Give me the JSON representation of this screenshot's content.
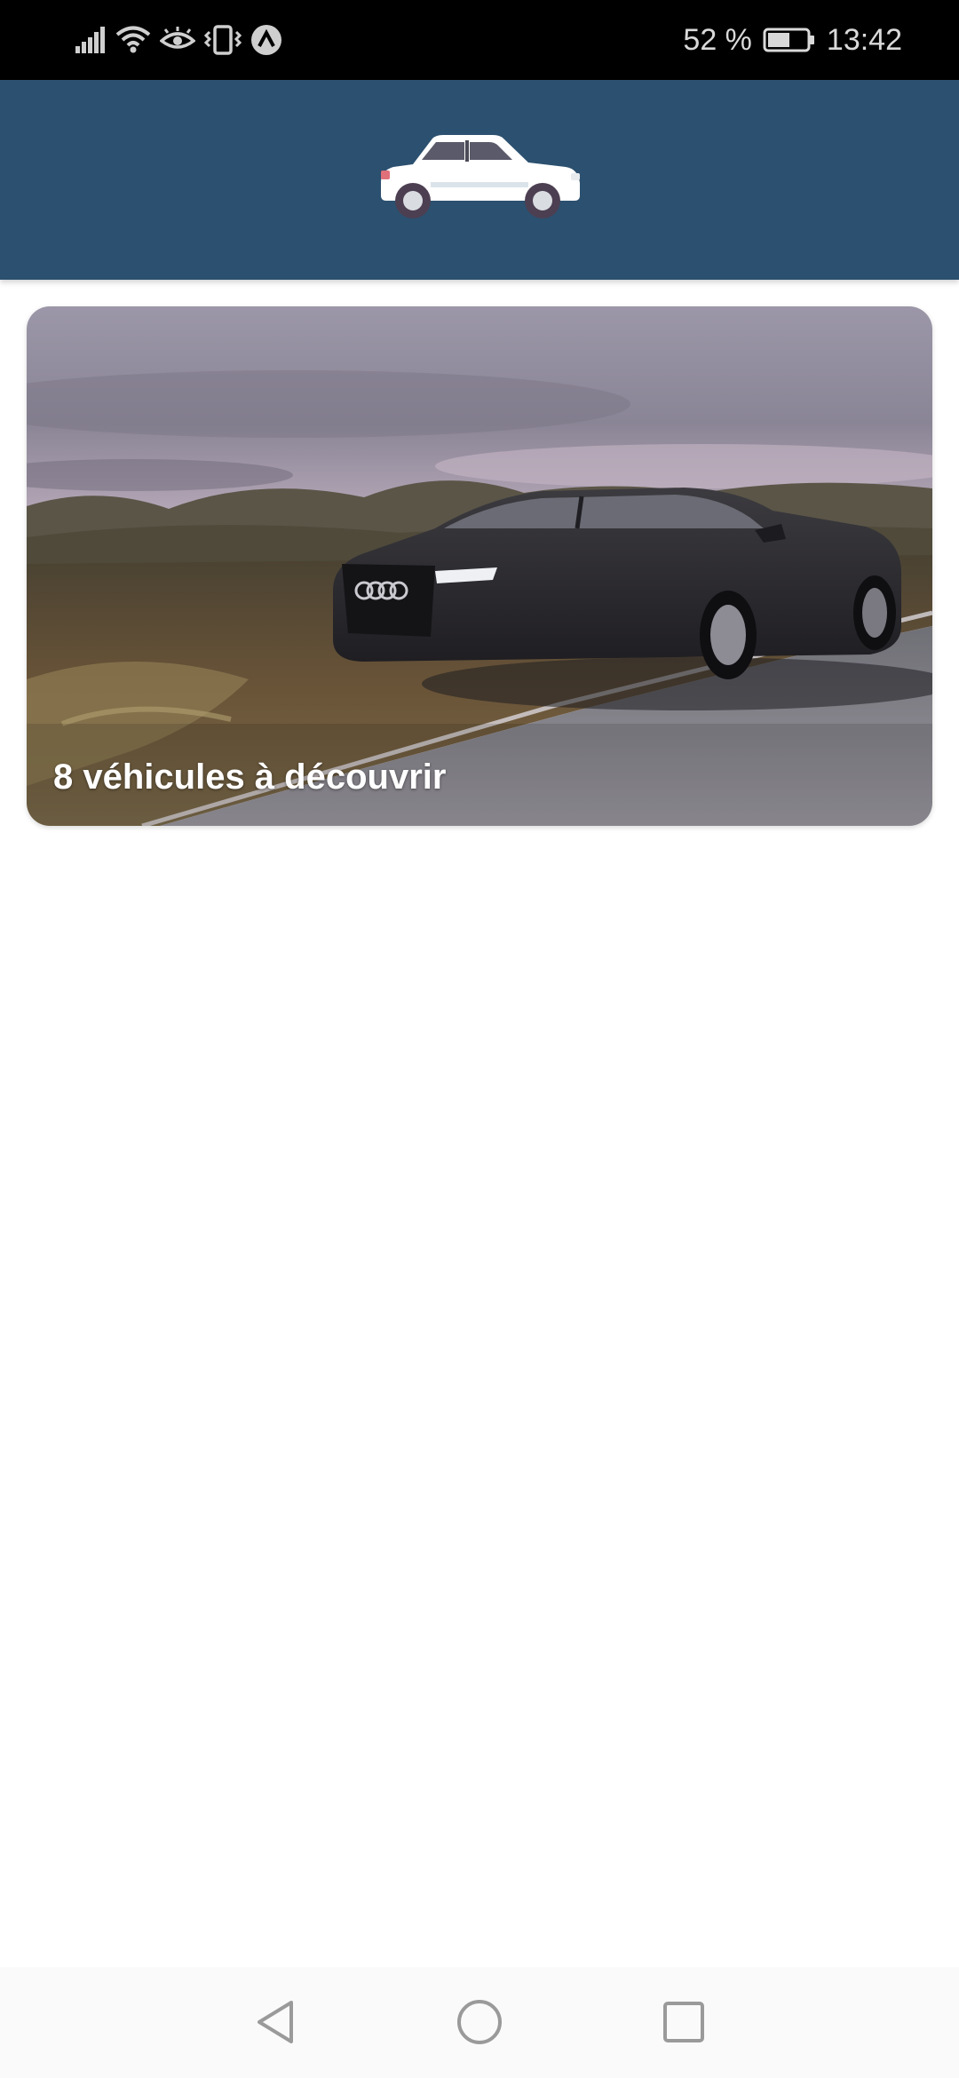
{
  "status_bar": {
    "battery_percent": "52 %",
    "time": "13:42",
    "icons": [
      "signal-icon",
      "wifi-icon",
      "eye-icon",
      "vibrate-icon",
      "app-notification-icon",
      "battery-icon"
    ]
  },
  "header": {
    "logo_icon": "car-icon",
    "colors": {
      "background": "#2c506f"
    }
  },
  "card": {
    "label": "8 véhicules à découvrir"
  },
  "nav_bar": {
    "icons": [
      "back-icon",
      "home-icon",
      "recents-icon"
    ]
  }
}
